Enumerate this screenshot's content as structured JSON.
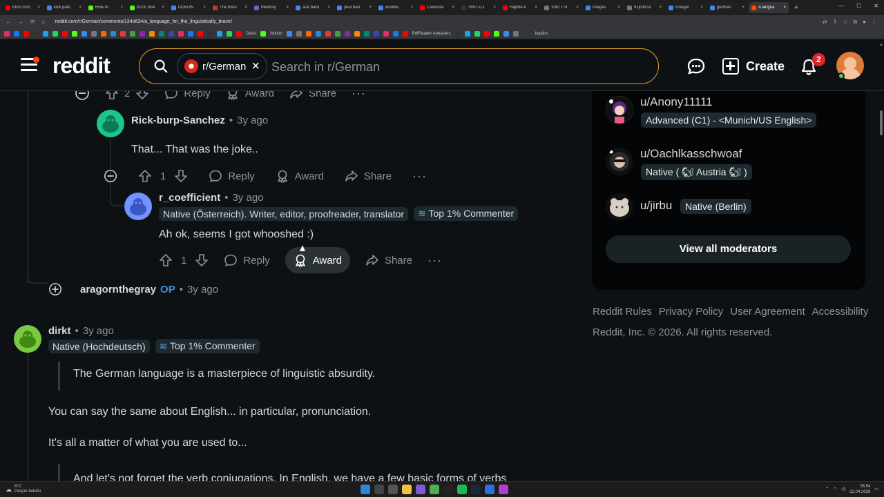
{
  "browser": {
    "tabs": [
      {
        "label": "Ebru Gün",
        "color": "#ff0000"
      },
      {
        "label": "kick parti",
        "color": "#4285f4"
      },
      {
        "label": "How to",
        "color": "#53fc18"
      },
      {
        "label": "KICK Stre",
        "color": "#53fc18"
      },
      {
        "label": "ODEON",
        "color": "#4285f4"
      },
      {
        "label": "The histo",
        "color": "#c0392b"
      },
      {
        "label": "Memory",
        "color": "#5c6bc0"
      },
      {
        "label": "a24 back",
        "color": "#4285f4"
      },
      {
        "label": "yeat bab",
        "color": "#4285f4"
      },
      {
        "label": "worldle",
        "color": "#4285f4"
      },
      {
        "label": "Clavicula",
        "color": "#ff0000"
      },
      {
        "label": "16ST-CJ",
        "color": "#333333"
      },
      {
        "label": "Hajime k",
        "color": "#ff0000"
      },
      {
        "label": "109777d",
        "color": "#777777"
      },
      {
        "label": "images",
        "color": "#4285f4"
      },
      {
        "label": "91jGW1s",
        "color": "#777777"
      },
      {
        "label": "Google",
        "color": "#4285f4"
      },
      {
        "label": "german",
        "color": "#4285f4"
      },
      {
        "label": "A langua",
        "color": "#ff4500",
        "active": true
      }
    ],
    "url": "reddit.com/r/German/comments/134o634/a_language_for_the_linguistically_brave/",
    "bookmarks": [
      "Oasis",
      "Notion",
      "PdfReader AnnasArc",
      "loyalist"
    ]
  },
  "header": {
    "logo": "reddit",
    "chip_label": "r/German",
    "search_placeholder": "Search in r/German",
    "create_label": "Create",
    "notif_count": "2"
  },
  "thread": {
    "top_actions": {
      "votes": "2",
      "reply": "Reply",
      "award": "Award",
      "share": "Share"
    },
    "c1": {
      "author": "Rick-burp-Sanchez",
      "time": "3y ago",
      "text": "That... That was the joke..",
      "votes": "1",
      "reply": "Reply",
      "award": "Award",
      "share": "Share"
    },
    "c2": {
      "author": "r_coefficient",
      "time": "3y ago",
      "flair": "Native (Österreich). Writer, editor, proofreader, translator",
      "badge": "Top 1% Commenter",
      "text": "Ah ok, seems I got whooshed :)",
      "votes": "1",
      "reply": "Reply",
      "award": "Award",
      "share": "Share"
    },
    "collapsed": {
      "author": "aragornthegray",
      "op": "OP",
      "time": "3y ago"
    },
    "c3": {
      "author": "dirkt",
      "time": "3y ago",
      "flair": "Native (Hochdeutsch)",
      "badge": "Top 1% Commenter",
      "quote": "The German language is a masterpiece of linguistic absurdity.",
      "p1": "You can say the same about English... in particular, pronunciation.",
      "p2": "It's all a matter of what you are used to...",
      "quote2": "And let's not forget the verb conjugations. In English, we have a few basic forms of verbs"
    },
    "separator": "•"
  },
  "sidebar": {
    "mods": [
      {
        "name": "u/Anony11111",
        "flair": "Advanced (C1) - <Munich/US English>"
      },
      {
        "name": "u/Oachlkasschwoaf",
        "flair": "Native ( 🐿 Austria 🐿 )"
      },
      {
        "name": "u/jirbu",
        "flair": "Native (Berlin)"
      }
    ],
    "view_all": "View all moderators",
    "footer_links": [
      "Reddit Rules",
      "Privacy Policy",
      "User Agreement",
      "Accessibility"
    ],
    "copyright": "Reddit, Inc. © 2026. All rights reserved."
  },
  "taskbar": {
    "weather_temp": "8°C",
    "weather_desc": "Parçalı bulutlu",
    "time": "05:54",
    "date": "22.04.2026"
  },
  "colors": {
    "accent": "#ff4500",
    "op": "#3e8ede",
    "search_border": "#f0a024"
  }
}
